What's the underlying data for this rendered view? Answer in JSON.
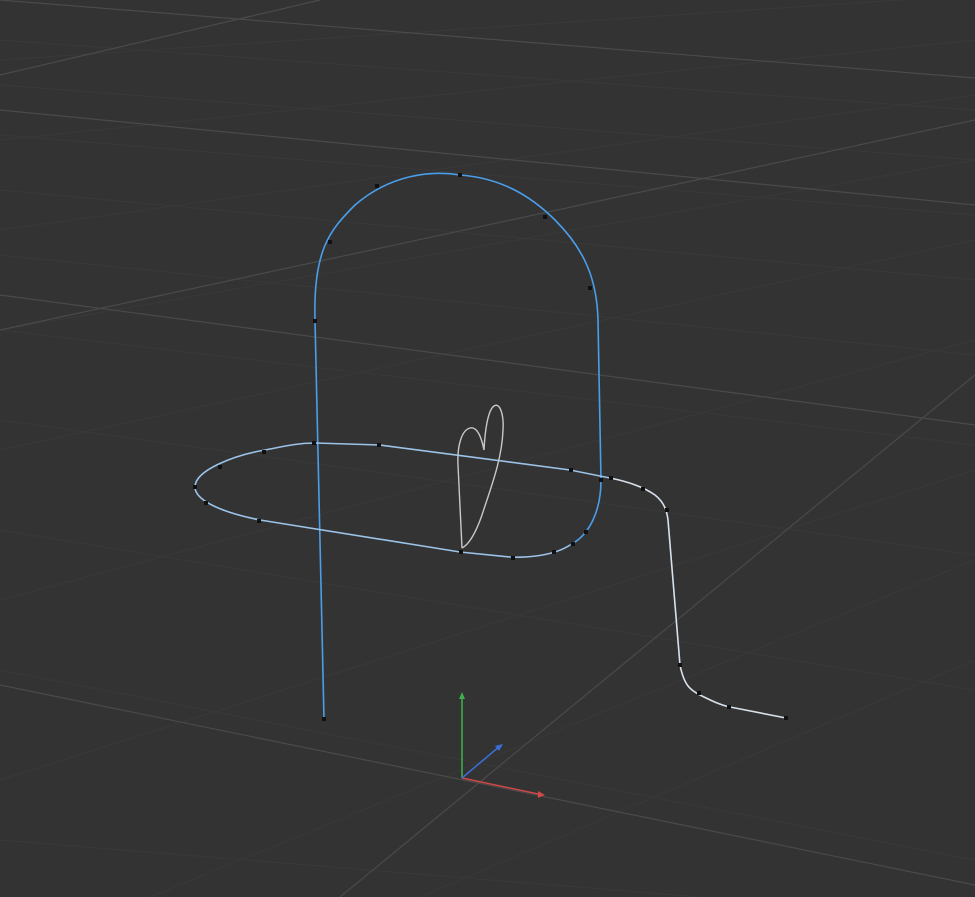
{
  "viewport": {
    "view": "perspective",
    "background": "#333333"
  },
  "grid": {
    "minor_color": "#3a3a3a",
    "major_color": "#4a4a4a"
  },
  "axes_gizmo": {
    "x_color": "#d04848",
    "y_color": "#3fb04f",
    "z_color": "#3a6fd8"
  },
  "curves": [
    {
      "name": "arch-curve",
      "color": "#4a9eea",
      "selected": true
    },
    {
      "name": "loop-curve",
      "color": "#9cc3e8",
      "selected": false
    },
    {
      "name": "step-curve",
      "color": "#d8e2ec",
      "selected": false
    },
    {
      "name": "heart-curve",
      "color": "#c8c8c8",
      "selected": false
    }
  ],
  "control_point_color": "#111111"
}
